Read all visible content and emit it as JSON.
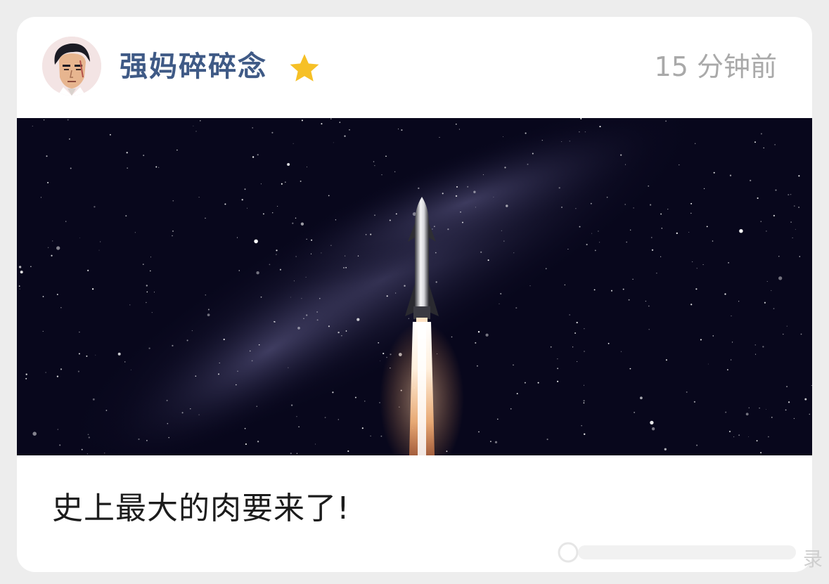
{
  "post": {
    "author": "强妈碎碎念",
    "badge_icon": "star-icon",
    "badge_color": "#f6c026",
    "time": "15 分钟前",
    "image_icon": "rocket-launch-in-starry-sky-image",
    "text": "史上最大的肉要来了!"
  },
  "watermark": {
    "icon": "weibo-logo-icon",
    "char": "录"
  },
  "colors": {
    "author_color": "#3f5a86",
    "time_color": "#a9a9a9",
    "page_background": "#ededed",
    "card_background": "#ffffff"
  }
}
